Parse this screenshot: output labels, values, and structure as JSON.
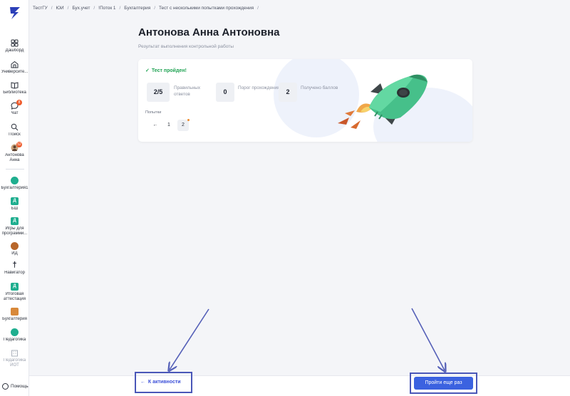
{
  "breadcrumb": [
    "ТестГУ",
    "ЮИ",
    "Бух.учет",
    "!Поток 1",
    "Бухгалтерия",
    "Тест с несколькими попытками прохождения"
  ],
  "sidebar": {
    "items": [
      {
        "label": "Дашборд",
        "icon": "dashboard-icon"
      },
      {
        "label": "Университе...",
        "icon": "university-icon"
      },
      {
        "label": "Библиотека",
        "icon": "book-icon"
      },
      {
        "label": "Чат",
        "icon": "chat-icon",
        "badge": "8"
      },
      {
        "label": "Поиск",
        "icon": "search-icon"
      },
      {
        "label": "Антонова Анна",
        "icon": "avatar",
        "badge": "52"
      }
    ],
    "courses": [
      {
        "label": "Бухгалтерия1",
        "badge_text": ""
      },
      {
        "label": "БШ",
        "badge_text": "Д"
      },
      {
        "label": "Игры для программи...",
        "badge_text": "Д"
      },
      {
        "label": "ИД",
        "badge_text": ""
      },
      {
        "label": "Навигатор",
        "badge_text": "†"
      },
      {
        "label": "Итоговая аттестация",
        "badge_text": "Д"
      },
      {
        "label": "Бухгалтерия",
        "badge_text": ""
      },
      {
        "label": "Педагогика",
        "badge_text": ""
      },
      {
        "label": "Педагогика ИОТ",
        "badge_text": ""
      }
    ],
    "help": "Помощь"
  },
  "main": {
    "title": "Антонова Анна Антоновна",
    "subtitle": "Результат выполнения контрольной работы",
    "status": "Тест пройден!",
    "stats": [
      {
        "value": "2/5",
        "caption": "Правильных ответов"
      },
      {
        "value": "0",
        "caption": "Порог прохождения"
      },
      {
        "value": "2",
        "caption": "Получено баллов"
      }
    ],
    "attempts_label": "Попытки",
    "attempts": [
      "1",
      "2"
    ],
    "active_attempt": "2"
  },
  "footer": {
    "back_label": "К активности",
    "retry_label": "Пройти еще раз"
  },
  "colors": {
    "accent": "#3b62e0",
    "success": "#22a455",
    "highlight_border": "#4a57b8"
  }
}
